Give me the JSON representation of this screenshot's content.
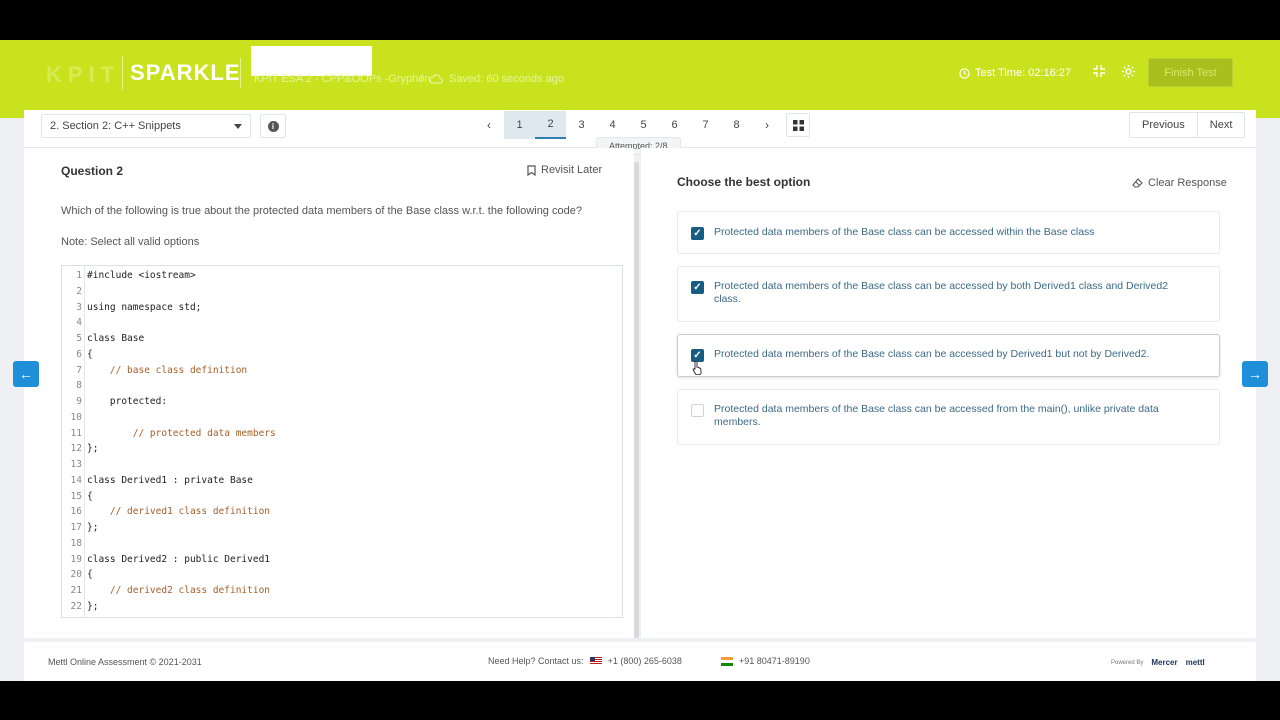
{
  "header": {
    "brand_faded": "KPIT",
    "brand": "SPARKLE",
    "test_name": "KPIT ESA 2 - CPP&OOPs -Gryphon",
    "saved_status": "Saved: 60 seconds ago",
    "timer": "Test Time: 02:16:27",
    "finish_label": "Finish Test",
    "colors": {
      "accent": "#c8e31e",
      "primary": "#175d82"
    }
  },
  "toolbar": {
    "section": "2. Section 2: C++ Snippets",
    "pages": [
      "1",
      "2",
      "3",
      "4",
      "5",
      "6",
      "7",
      "8"
    ],
    "current_page": "2",
    "attempted": "Attempted: 2/8",
    "previous_label": "Previous",
    "next_label": "Next"
  },
  "question": {
    "title": "Question 2",
    "revisit_label": "Revisit Later",
    "text": "Which of the following is true about the protected data members of the Base class w.r.t. the following code?",
    "note": "Note: Select all valid options",
    "code": [
      {
        "n": "1",
        "t": "#include <iostream>",
        "c": false
      },
      {
        "n": "2",
        "t": "",
        "c": false
      },
      {
        "n": "3",
        "t": "using namespace std;",
        "c": false
      },
      {
        "n": "4",
        "t": "",
        "c": false
      },
      {
        "n": "5",
        "t": "class Base",
        "c": false
      },
      {
        "n": "6",
        "t": "{",
        "c": false
      },
      {
        "n": "7",
        "t": "    // base class definition",
        "c": true
      },
      {
        "n": "8",
        "t": "",
        "c": false
      },
      {
        "n": "9",
        "t": "    protected:",
        "c": false
      },
      {
        "n": "10",
        "t": "",
        "c": false
      },
      {
        "n": "11",
        "t": "        // protected data members",
        "c": true
      },
      {
        "n": "12",
        "t": "};",
        "c": false
      },
      {
        "n": "13",
        "t": "",
        "c": false
      },
      {
        "n": "14",
        "t": "class Derived1 : private Base",
        "c": false
      },
      {
        "n": "15",
        "t": "{",
        "c": false
      },
      {
        "n": "16",
        "t": "    // derived1 class definition",
        "c": true
      },
      {
        "n": "17",
        "t": "};",
        "c": false
      },
      {
        "n": "18",
        "t": "",
        "c": false
      },
      {
        "n": "19",
        "t": "class Derived2 : public Derived1",
        "c": false
      },
      {
        "n": "20",
        "t": "{",
        "c": false
      },
      {
        "n": "21",
        "t": "    // derived2 class definition",
        "c": true
      },
      {
        "n": "22",
        "t": "};",
        "c": false
      }
    ]
  },
  "answer": {
    "prompt": "Choose the best option",
    "clear_label": "Clear Response",
    "options": [
      {
        "label": "Protected data members of the Base class can be accessed within the Base class",
        "checked": true
      },
      {
        "label": "Protected data members of the Base class can be accessed by both Derived1 class and Derived2 class.",
        "checked": true
      },
      {
        "label": "Protected data members of the Base class can be accessed by Derived1 but not by Derived2.",
        "checked": true
      },
      {
        "label": "Protected data members of the Base class can be accessed from the main(), unlike private data members.",
        "checked": false
      }
    ]
  },
  "footer": {
    "copyright": "Mettl Online Assessment © 2021-2031",
    "help_label": "Need Help? Contact us:",
    "phone_us": "+1 (800) 265-6038",
    "phone_in": "+91 80471-89190",
    "powered_by": "Powered By",
    "mercer": "Mercer",
    "mettl": "mettl"
  }
}
